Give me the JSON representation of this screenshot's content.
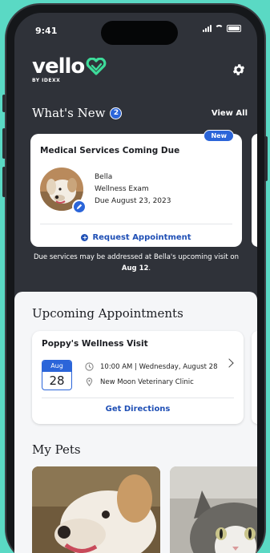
{
  "status_bar": {
    "time": "9:41"
  },
  "brand": {
    "name": "vello",
    "tagline": "BY IDEXX"
  },
  "whats_new": {
    "title": "What's New",
    "count": "2",
    "view_all": "View All",
    "card": {
      "badge": "New",
      "title": "Medical Services Coming Due",
      "pet_name": "Bella",
      "service": "Wellness Exam",
      "due": "Due August 23, 2023",
      "action": "Request Appointment"
    },
    "note_prefix": "Due services may be addressed at Bella's upcoming visit on ",
    "note_date": "Aug 12",
    "note_suffix": "."
  },
  "upcoming": {
    "title": "Upcoming Appointments",
    "card": {
      "title": "Poppy's Wellness Visit",
      "month": "Aug",
      "day": "28",
      "time": "10:00 AM | Wednesday, August 28",
      "location": "New Moon Veterinary Clinic",
      "action": "Get Directions"
    }
  },
  "my_pets": {
    "title": "My Pets"
  },
  "colors": {
    "accent": "#2b65d9",
    "link": "#1f4fb5",
    "brand_green": "#3ddc9a",
    "dark_bg": "#2f3239",
    "frame_bg": "#5ad9c4"
  },
  "icons": [
    "vello-heart-logo",
    "gear-icon",
    "edit-icon",
    "plus-circle-icon",
    "clock-icon",
    "location-pin-icon",
    "chevron-right-icon"
  ]
}
